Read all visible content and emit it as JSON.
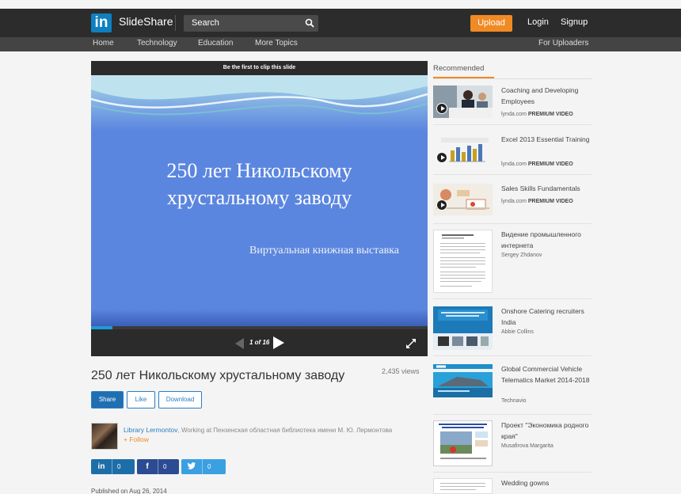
{
  "header": {
    "logo": "in",
    "brand": "SlideShare",
    "search_placeholder": "Search",
    "upload": "Upload",
    "login": "Login",
    "signup": "Signup"
  },
  "nav": {
    "home": "Home",
    "technology": "Technology",
    "education": "Education",
    "more": "More Topics",
    "uploaders": "For Uploaders"
  },
  "player": {
    "clip_text": "Be the first to clip this slide",
    "slide_title_line1": "250 лет Никольскому",
    "slide_title_line2": "хрустальному заводу",
    "slide_subtitle": "Виртуальная книжная выставка",
    "page_indicator": "1 of 16",
    "progress_fraction": 0.0625,
    "slide_color": "#5b86e0"
  },
  "doc": {
    "title": "250 лет Никольскому хрустальному заводу",
    "views": "2,435 views",
    "share": "Share",
    "like": "Like",
    "download": "Download",
    "author": "Library Lermontov",
    "author_info": ", Working at Пензенская областная библиотека имени М. Ю. Лермонтова",
    "follow": "+ Follow",
    "linkedin_count": "0",
    "facebook_count": "0",
    "twitter_count": "0",
    "published": "Published on Aug 26, 2014"
  },
  "sidebar": {
    "heading": "Recommended",
    "items": [
      {
        "title": "Coaching and Developing Employees",
        "source": "lynda.com",
        "badge": "PREMIUM VIDEO"
      },
      {
        "title": "Excel 2013 Essential Training",
        "source": "lynda.com",
        "badge": "PREMIUM VIDEO"
      },
      {
        "title": "Sales Skills Fundamentals",
        "source": "lynda.com",
        "badge": "PREMIUM VIDEO"
      },
      {
        "title": "Видение промышленного интернета",
        "source": "Sergey Zhdanov",
        "badge": ""
      },
      {
        "title": "Onshore Catering recruiters India",
        "source": "Abbie Collins",
        "badge": ""
      },
      {
        "title": "Global Commercial Vehicle Telematics Market 2014-2018",
        "source": "Technavio",
        "badge": ""
      },
      {
        "title": "Проект \"Экономика родного края\"",
        "source": "Musafirova Margarita",
        "badge": ""
      },
      {
        "title": "Wedding gowns",
        "source": "",
        "badge": ""
      }
    ]
  },
  "colors": {
    "accent": "#f08a24",
    "linkedin_blue": "#0f7fc0",
    "link": "#2a7fc1"
  }
}
